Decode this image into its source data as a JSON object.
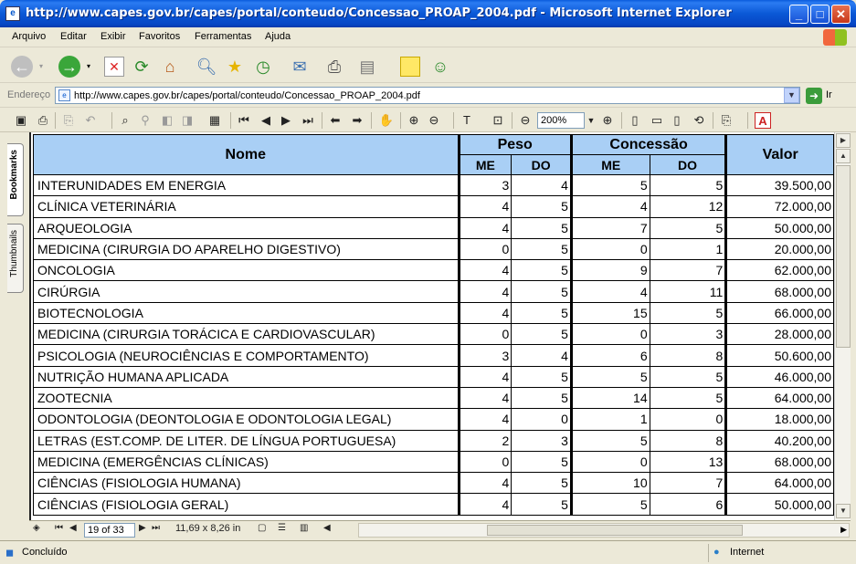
{
  "window": {
    "title": "http://www.capes.gov.br/capes/portal/conteudo/Concessao_PROAP_2004.pdf - Microsoft Internet Explorer"
  },
  "menu": [
    "Arquivo",
    "Editar",
    "Exibir",
    "Favoritos",
    "Ferramentas",
    "Ajuda"
  ],
  "address": {
    "label": "Endereço",
    "url": "http://www.capes.gov.br/capes/portal/conteudo/Concessao_PROAP_2004.pdf",
    "go_label": "Ir"
  },
  "acrobat": {
    "zoom": "200%"
  },
  "sidebar_tabs": [
    "Bookmarks",
    "Thumbnails"
  ],
  "table": {
    "headers": {
      "nome": "Nome",
      "peso": "Peso",
      "concessao": "Concessão",
      "valor": "Valor",
      "me": "ME",
      "do": "DO"
    },
    "rows": [
      {
        "nome": "INTERUNIDADES EM ENERGIA",
        "peso_me": "3",
        "peso_do": "4",
        "conc_me": "5",
        "conc_do": "5",
        "valor": "39.500,00"
      },
      {
        "nome": "CLÍNICA VETERINÁRIA",
        "peso_me": "4",
        "peso_do": "5",
        "conc_me": "4",
        "conc_do": "12",
        "valor": "72.000,00"
      },
      {
        "nome": "ARQUEOLOGIA",
        "peso_me": "4",
        "peso_do": "5",
        "conc_me": "7",
        "conc_do": "5",
        "valor": "50.000,00"
      },
      {
        "nome": "MEDICINA (CIRURGIA DO APARELHO DIGESTIVO)",
        "peso_me": "0",
        "peso_do": "5",
        "conc_me": "0",
        "conc_do": "1",
        "valor": "20.000,00"
      },
      {
        "nome": "ONCOLOGIA",
        "peso_me": "4",
        "peso_do": "5",
        "conc_me": "9",
        "conc_do": "7",
        "valor": "62.000,00"
      },
      {
        "nome": "CIRÚRGIA",
        "peso_me": "4",
        "peso_do": "5",
        "conc_me": "4",
        "conc_do": "11",
        "valor": "68.000,00"
      },
      {
        "nome": "BIOTECNOLOGIA",
        "peso_me": "4",
        "peso_do": "5",
        "conc_me": "15",
        "conc_do": "5",
        "valor": "66.000,00"
      },
      {
        "nome": "MEDICINA (CIRURGIA TORÁCICA E CARDIOVASCULAR)",
        "peso_me": "0",
        "peso_do": "5",
        "conc_me": "0",
        "conc_do": "3",
        "valor": "28.000,00"
      },
      {
        "nome": "PSICOLOGIA (NEUROCIÊNCIAS E COMPORTAMENTO)",
        "peso_me": "3",
        "peso_do": "4",
        "conc_me": "6",
        "conc_do": "8",
        "valor": "50.600,00"
      },
      {
        "nome": "NUTRIÇÃO HUMANA APLICADA",
        "peso_me": "4",
        "peso_do": "5",
        "conc_me": "5",
        "conc_do": "5",
        "valor": "46.000,00"
      },
      {
        "nome": "ZOOTECNIA",
        "peso_me": "4",
        "peso_do": "5",
        "conc_me": "14",
        "conc_do": "5",
        "valor": "64.000,00"
      },
      {
        "nome": "ODONTOLOGIA (DEONTOLOGIA E ODONTOLOGIA LEGAL)",
        "peso_me": "4",
        "peso_do": "0",
        "conc_me": "1",
        "conc_do": "0",
        "valor": "18.000,00"
      },
      {
        "nome": "LETRAS (EST.COMP. DE LITER. DE LÍNGUA PORTUGUESA)",
        "peso_me": "2",
        "peso_do": "3",
        "conc_me": "5",
        "conc_do": "8",
        "valor": "40.200,00"
      },
      {
        "nome": "MEDICINA  (EMERGÊNCIAS CLÍNICAS)",
        "peso_me": "0",
        "peso_do": "5",
        "conc_me": "0",
        "conc_do": "13",
        "valor": "68.000,00"
      },
      {
        "nome": "CIÊNCIAS (FISIOLOGIA HUMANA)",
        "peso_me": "4",
        "peso_do": "5",
        "conc_me": "10",
        "conc_do": "7",
        "valor": "64.000,00"
      },
      {
        "nome": "CIÊNCIAS (FISIOLOGIA GERAL)",
        "peso_me": "4",
        "peso_do": "5",
        "conc_me": "5",
        "conc_do": "6",
        "valor": "50.000,00"
      }
    ]
  },
  "navigation": {
    "page": "19 of 33",
    "page_size": "11,69 x 8,26 in"
  },
  "status": {
    "text": "Concluído",
    "zone": "Internet"
  }
}
